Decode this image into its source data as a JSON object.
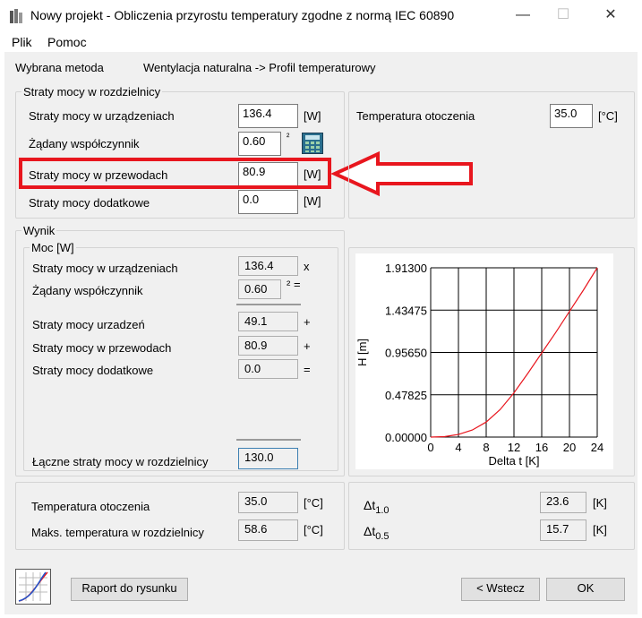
{
  "window": {
    "title": "Nowy projekt - Obliczenia przyrostu temperatury zgodne z normą IEC 60890",
    "minimize_label": "—",
    "maximize_label": "☐",
    "close_label": "✕"
  },
  "menu": [
    "Plik",
    "Pomoc"
  ],
  "method": {
    "label": "Wybrana metoda",
    "value": "Wentylacja naturalna -> Profil temperaturowy"
  },
  "losses": {
    "legend": "Straty mocy w rozdzielnicy",
    "rows": [
      {
        "label": "Straty mocy w urządzeniach",
        "value": "136.4",
        "unit": "[W]"
      },
      {
        "label": "Żądany współczynnik",
        "value": "0.60",
        "unit": "²"
      },
      {
        "label": "Straty mocy w przewodach",
        "value": "80.9",
        "unit": "[W]"
      },
      {
        "label": "Straty mocy dodatkowe",
        "value": "0.0",
        "unit": "[W]"
      }
    ]
  },
  "ambient": {
    "label": "Temperatura otoczenia",
    "value": "35.0",
    "unit": "[°C]"
  },
  "result": {
    "legend": "Wynik",
    "power_legend": "Moc [W]",
    "rows": [
      {
        "label": "Straty mocy w urządzeniach",
        "value": "136.4",
        "op": "x"
      },
      {
        "label": "Żądany współczynnik",
        "value": "0.60",
        "op": "² ="
      },
      {
        "label": "Straty mocy urzadzeń",
        "value": "49.1",
        "op": "+"
      },
      {
        "label": "Straty mocy w przewodach",
        "value": "80.9",
        "op": "+"
      },
      {
        "label": "Straty mocy dodatkowe",
        "value": "0.0",
        "op": "="
      }
    ],
    "total_label": "Łączne straty mocy w rozdzielnicy",
    "total_value": "130.0"
  },
  "temps": {
    "ambient_label": "Temperatura otoczenia",
    "ambient_value": "35.0",
    "ambient_unit": "[°C]",
    "max_label": "Maks. temperatura w rozdzielnicy",
    "max_value": "58.6",
    "max_unit": "[°C]",
    "dt10_label": "Δt",
    "dt10_sub": "1.0",
    "dt10_value": "23.6",
    "dt10_unit": "[K]",
    "dt05_label": "Δt",
    "dt05_sub": "0.5",
    "dt05_value": "15.7",
    "dt05_unit": "[K]"
  },
  "buttons": {
    "report": "Raport do rysunku",
    "back": "< Wstecz",
    "ok": "OK"
  },
  "chart_data": {
    "type": "line",
    "xlabel": "Delta t [K]",
    "ylabel": "H [m]",
    "xlim": [
      0,
      24
    ],
    "ylim": [
      0,
      1.913
    ],
    "x_ticks": [
      "0",
      "4",
      "8",
      "12",
      "16",
      "20",
      "24"
    ],
    "y_ticks": [
      "0.00000",
      "0.47825",
      "0.95650",
      "1.43475",
      "1.91300"
    ],
    "grid": true,
    "series": [
      {
        "color": "#e8161e",
        "x": [
          0,
          2,
          4,
          6,
          8,
          10,
          12,
          14,
          16,
          18,
          20,
          22,
          24
        ],
        "y": [
          0.0,
          0.005,
          0.03,
          0.08,
          0.17,
          0.31,
          0.5,
          0.72,
          0.95,
          1.18,
          1.42,
          1.66,
          1.913
        ]
      }
    ]
  }
}
